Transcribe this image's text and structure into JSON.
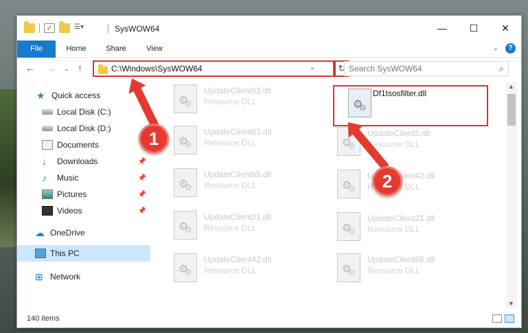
{
  "window": {
    "title": "SysWOW64",
    "controls": {
      "minimize": "—",
      "maximize": "☐",
      "close": "✕"
    }
  },
  "ribbon": {
    "tabs": [
      "File",
      "Home",
      "Share",
      "View"
    ],
    "help_label": "?"
  },
  "address_bar": {
    "path": "C:\\Windows\\SysWOW64",
    "search_placeholder": "Search SysWOW64"
  },
  "nav_pane": {
    "items": [
      {
        "label": "Quick access",
        "icon": "star-icon"
      },
      {
        "label": "Local Disk (C:)",
        "icon": "drive-icon"
      },
      {
        "label": "Local Disk (D:)",
        "icon": "drive-icon"
      },
      {
        "label": "Documents",
        "icon": "documents-icon"
      },
      {
        "label": "Downloads",
        "icon": "download-icon"
      },
      {
        "label": "Music",
        "icon": "music-icon"
      },
      {
        "label": "Pictures",
        "icon": "pictures-icon"
      },
      {
        "label": "Videos",
        "icon": "videos-icon"
      },
      {
        "label": "OneDrive",
        "icon": "cloud-icon"
      },
      {
        "label": "This PC",
        "icon": "computer-icon",
        "selected": true
      },
      {
        "label": "Network",
        "icon": "network-icon"
      }
    ]
  },
  "files": {
    "left_column": [
      {
        "name": "UpdateClient63.dll",
        "type": "Resource DLL"
      },
      {
        "name": "UpdateClient63.dll",
        "type": "Resource DLL"
      },
      {
        "name": "UpdateClient65.dll",
        "type": "Resource DLL"
      },
      {
        "name": "UpdateClient21.dll",
        "type": "Resource DLL"
      },
      {
        "name": "UpdateClient42.dll",
        "type": "Resource DLL"
      }
    ],
    "right_column": [
      {
        "name": "Df1tsosfilter.dll",
        "type": ""
      },
      {
        "name": "UpdateClient5.dll",
        "type": "Resource DLL"
      },
      {
        "name": "UpdateClient42.dll",
        "type": "Resource DLL"
      },
      {
        "name": "UpdateClient21.dll",
        "type": "Resource DLL"
      },
      {
        "name": "UpdateClient65.dll",
        "type": "Resource DLL"
      }
    ]
  },
  "status": {
    "item_count": "140 items"
  },
  "callouts": {
    "step1": "1",
    "step2": "2"
  },
  "colors": {
    "accent": "#1979ca",
    "callout_red": "#e53a2f",
    "selection": "#cce8ff"
  }
}
